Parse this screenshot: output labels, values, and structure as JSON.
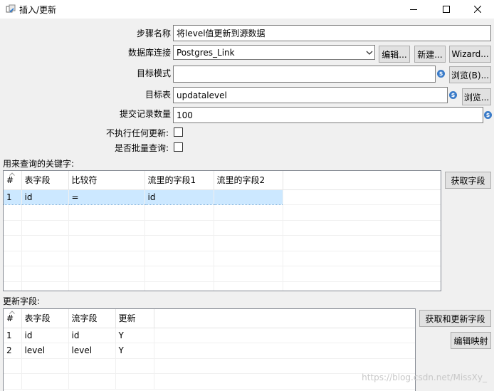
{
  "window": {
    "title": "插入/更新",
    "minimize_icon": "minimize-icon",
    "maximize_icon": "maximize-icon",
    "close_icon": "close-icon"
  },
  "form": {
    "step_name_label": "步骤名称",
    "step_name_value": "将level值更新到源数据",
    "db_connection_label": "数据库连接",
    "db_connection_value": "Postgres_Link",
    "edit_button": "编辑...",
    "new_button": "新建...",
    "wizard_button": "Wizard...",
    "target_schema_label": "目标模式",
    "target_schema_value": "",
    "browse_schema_button": "浏览(B)...",
    "target_table_label": "目标表",
    "target_table_value": "updatalevel",
    "browse_table_button": "浏览...",
    "commit_size_label": "提交记录数量",
    "commit_size_value": "100",
    "no_update_label": "不执行任何更新:",
    "batch_query_label": "是否批量查询:",
    "variable_icon": "$"
  },
  "key_section": {
    "label": "用来查询的关键字:",
    "get_fields_button": "获取字段",
    "columns": [
      "#",
      "表字段",
      "比较符",
      "流里的字段1",
      "流里的字段2"
    ],
    "rows": [
      [
        "1",
        "id",
        "=",
        "id",
        ""
      ]
    ]
  },
  "update_section": {
    "label": "更新字段:",
    "get_update_button": "获取和更新字段",
    "edit_mapping_button": "编辑映射",
    "columns": [
      "#",
      "表字段",
      "流字段",
      "更新"
    ],
    "rows": [
      [
        "1",
        "id",
        "id",
        "Y"
      ],
      [
        "2",
        "level",
        "level",
        "Y"
      ]
    ]
  },
  "watermark": "https://blog.csdn.net/MissXy_"
}
